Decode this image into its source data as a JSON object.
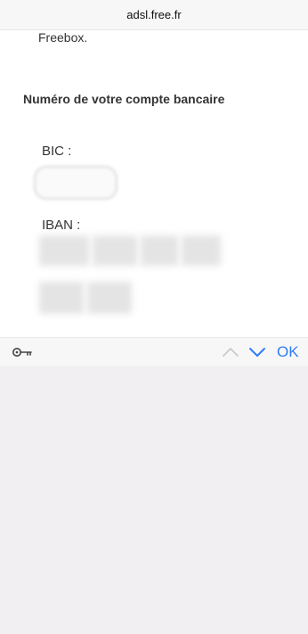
{
  "browser": {
    "url": "adsl.free.fr"
  },
  "page": {
    "intro_text": "Freebox.",
    "section_title": "Numéro de votre compte bancaire",
    "bic_label": "BIC :",
    "iban_label": "IBAN :"
  },
  "accessory_bar": {
    "key_icon": "key-icon",
    "prev_icon": "chevron-up-icon",
    "next_icon": "chevron-down-icon",
    "ok_label": "OK"
  },
  "colors": {
    "accent": "#2f7df6",
    "bar_bg": "#f8f7f8",
    "keyboard_bg": "#f1eff2"
  }
}
